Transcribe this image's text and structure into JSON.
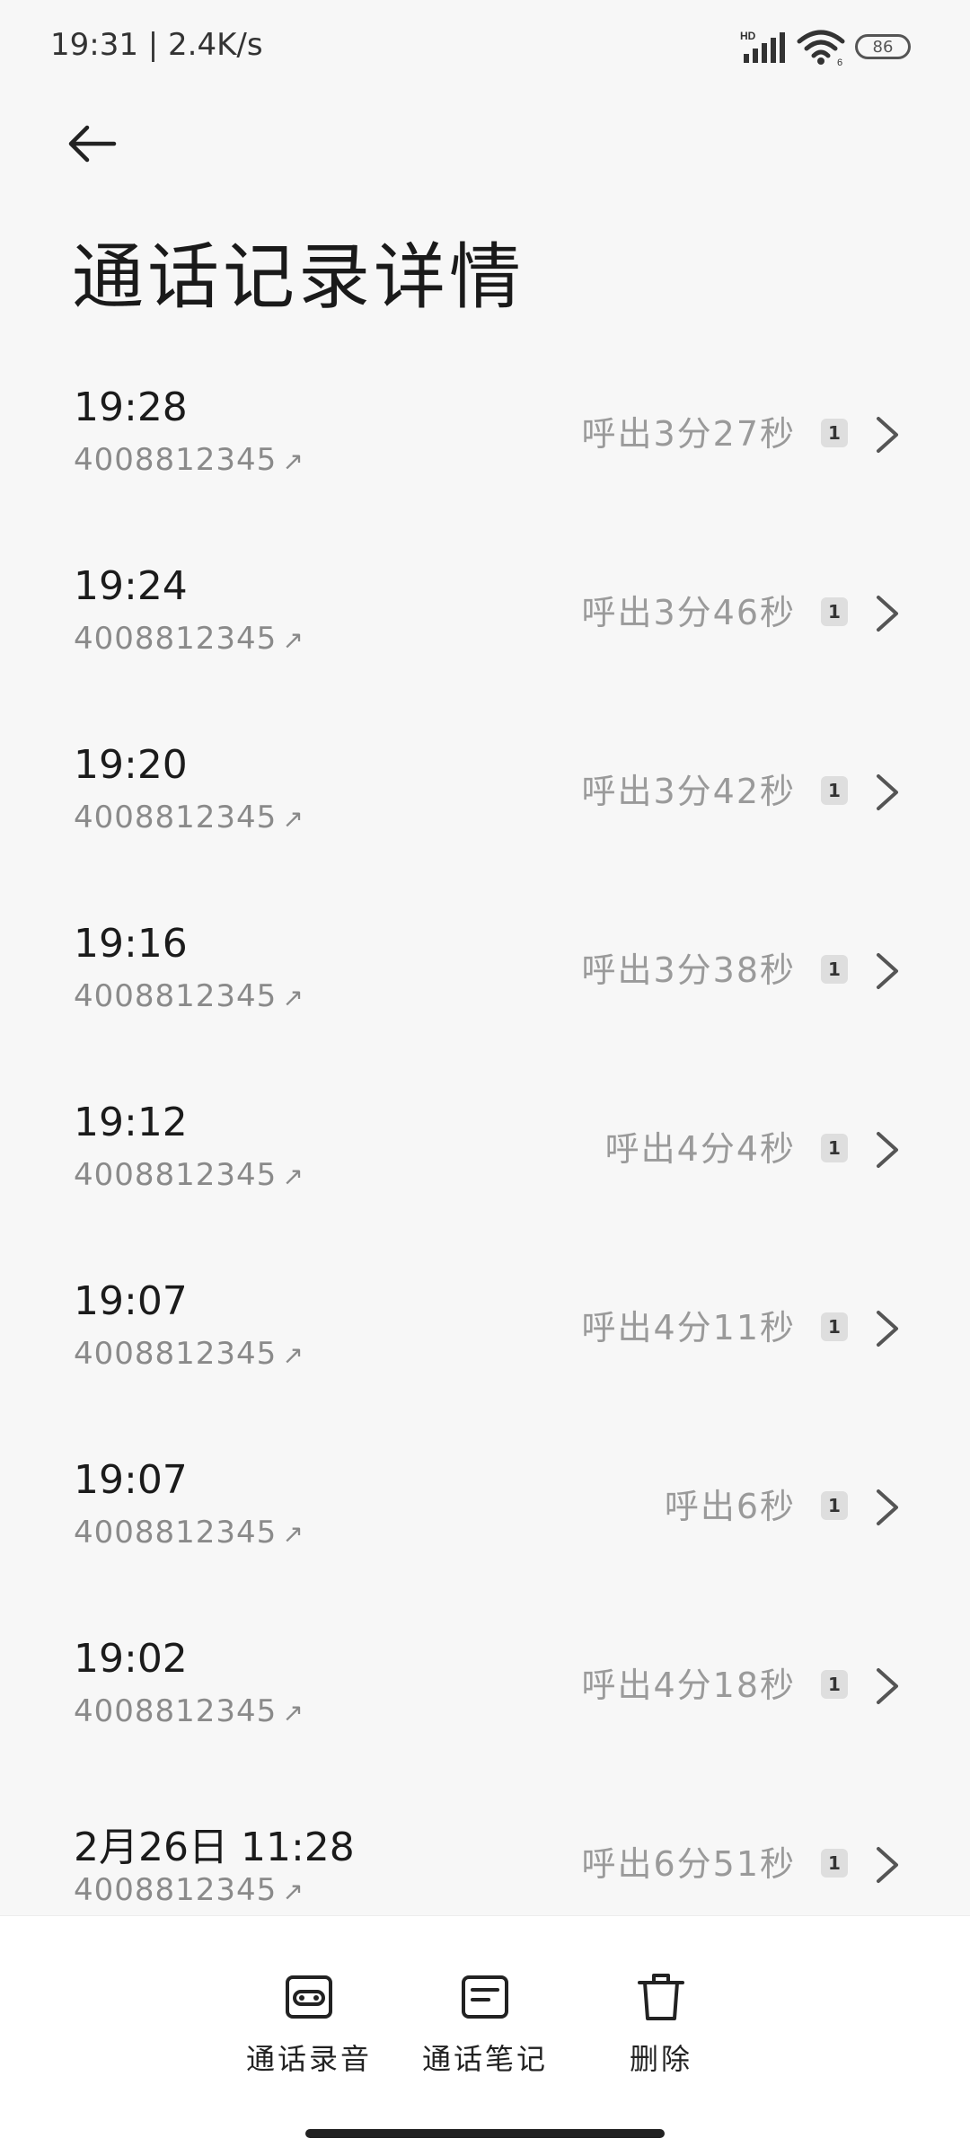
{
  "status_bar": {
    "time_speed": "19:31 | 2.4K/s",
    "battery": "86",
    "network_label": "HD",
    "wifi_label": "6"
  },
  "header": {
    "title": "通话记录详情"
  },
  "calls": [
    {
      "time": "19:28",
      "number": "4008812345",
      "duration": "呼出3分27秒",
      "sim": "1"
    },
    {
      "time": "19:24",
      "number": "4008812345",
      "duration": "呼出3分46秒",
      "sim": "1"
    },
    {
      "time": "19:20",
      "number": "4008812345",
      "duration": "呼出3分42秒",
      "sim": "1"
    },
    {
      "time": "19:16",
      "number": "4008812345",
      "duration": "呼出3分38秒",
      "sim": "1"
    },
    {
      "time": "19:12",
      "number": "4008812345",
      "duration": "呼出4分4秒",
      "sim": "1"
    },
    {
      "time": "19:07",
      "number": "4008812345",
      "duration": "呼出4分11秒",
      "sim": "1"
    },
    {
      "time": "19:07",
      "number": "4008812345",
      "duration": "呼出6秒",
      "sim": "1"
    },
    {
      "time": "19:02",
      "number": "4008812345",
      "duration": "呼出4分18秒",
      "sim": "1"
    },
    {
      "time": "2月26日 11:28",
      "number": "4008812345",
      "duration": "呼出6分51秒",
      "sim": "1"
    }
  ],
  "outgoing_symbol": "↗",
  "toolbar": {
    "recording_label": "通话录音",
    "notes_label": "通话笔记",
    "delete_label": "删除"
  },
  "icons": {
    "back": "back-arrow-icon",
    "chevron": "chevron-right-icon",
    "recording": "tape-icon",
    "notes": "note-icon",
    "delete": "trash-icon"
  }
}
